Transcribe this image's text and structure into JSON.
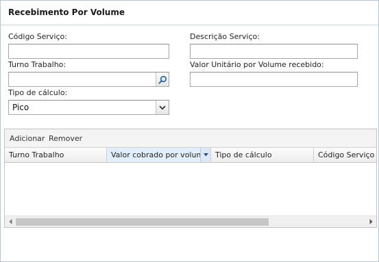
{
  "panel": {
    "title": "Recebimento Por Volume"
  },
  "form": {
    "codigo_servico": {
      "label": "Código Serviço:",
      "value": ""
    },
    "descricao_servico": {
      "label": "Descrição Serviço:",
      "value": ""
    },
    "turno_trabalho": {
      "label": "Turno Trabalho:",
      "value": "",
      "trigger_icon": "search-icon"
    },
    "valor_unitario": {
      "label": "Valor Unitário por Volume recebido:",
      "value": ""
    },
    "tipo_calculo": {
      "label": "Tipo de cálculo:",
      "value": "Pico",
      "trigger_icon": "chevron-down-icon"
    }
  },
  "grid": {
    "toolbar": {
      "add_label": "Adicionar",
      "remove_label": "Remover"
    },
    "columns": [
      {
        "label": "Turno Trabalho"
      },
      {
        "label": "Valor cobrado por volume",
        "sorted": true
      },
      {
        "label": "Tipo de cálculo"
      },
      {
        "label": "Código Serviço"
      }
    ],
    "rows": []
  },
  "colors": {
    "accent_border": "#b5c5d6",
    "active_column": "#e3eefb",
    "icon": "#2f5f9a"
  }
}
